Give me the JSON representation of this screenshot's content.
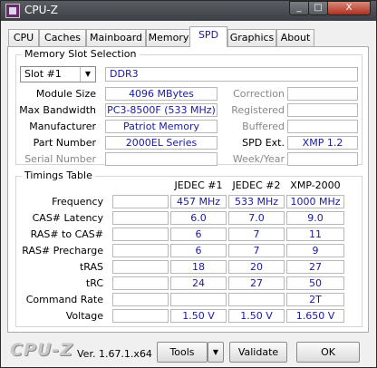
{
  "window": {
    "title": "CPU-Z",
    "controls": [
      "_",
      "□",
      "X"
    ]
  },
  "tabs": [
    {
      "label": "CPU"
    },
    {
      "label": "Caches"
    },
    {
      "label": "Mainboard"
    },
    {
      "label": "Memory"
    },
    {
      "label": "SPD",
      "active": true
    },
    {
      "label": "Graphics"
    },
    {
      "label": "About"
    }
  ],
  "slot": {
    "group_title": "Memory Slot Selection",
    "selected_slot": "Slot #1",
    "memory_type": "DDR3",
    "left_fields": [
      {
        "label": "Module Size",
        "value": "4096 MBytes"
      },
      {
        "label": "Max Bandwidth",
        "value": "PC3-8500F (533 MHz)"
      },
      {
        "label": "Manufacturer",
        "value": "Patriot Memory"
      },
      {
        "label": "Part Number",
        "value": "2000EL Series"
      },
      {
        "label": "Serial Number",
        "value": ""
      }
    ],
    "right_fields": [
      {
        "label": "Correction",
        "value": ""
      },
      {
        "label": "Registered",
        "value": ""
      },
      {
        "label": "Buffered",
        "value": ""
      },
      {
        "label": "SPD Ext.",
        "value": "XMP 1.2"
      },
      {
        "label": "Week/Year",
        "value": ""
      }
    ]
  },
  "timings": {
    "group_title": "Timings Table",
    "columns": [
      "JEDEC #1",
      "JEDEC #2",
      "XMP-2000"
    ],
    "rows": [
      {
        "label": "Frequency",
        "values": [
          "457 MHz",
          "533 MHz",
          "1000 MHz"
        ]
      },
      {
        "label": "CAS# Latency",
        "values": [
          "6.0",
          "7.0",
          "9.0"
        ]
      },
      {
        "label": "RAS# to CAS#",
        "values": [
          "6",
          "7",
          "11"
        ]
      },
      {
        "label": "RAS# Precharge",
        "values": [
          "6",
          "7",
          "9"
        ]
      },
      {
        "label": "tRAS",
        "values": [
          "18",
          "20",
          "27"
        ]
      },
      {
        "label": "tRC",
        "values": [
          "24",
          "27",
          "50"
        ]
      },
      {
        "label": "Command Rate",
        "values": [
          "",
          "",
          "2T"
        ]
      },
      {
        "label": "Voltage",
        "values": [
          "1.50 V",
          "1.50 V",
          "1.650 V"
        ]
      }
    ]
  },
  "footer": {
    "logo": "CPU-Z",
    "version": "Ver. 1.67.1.x64",
    "tools_label": "Tools",
    "validate_label": "Validate",
    "ok_label": "OK"
  }
}
